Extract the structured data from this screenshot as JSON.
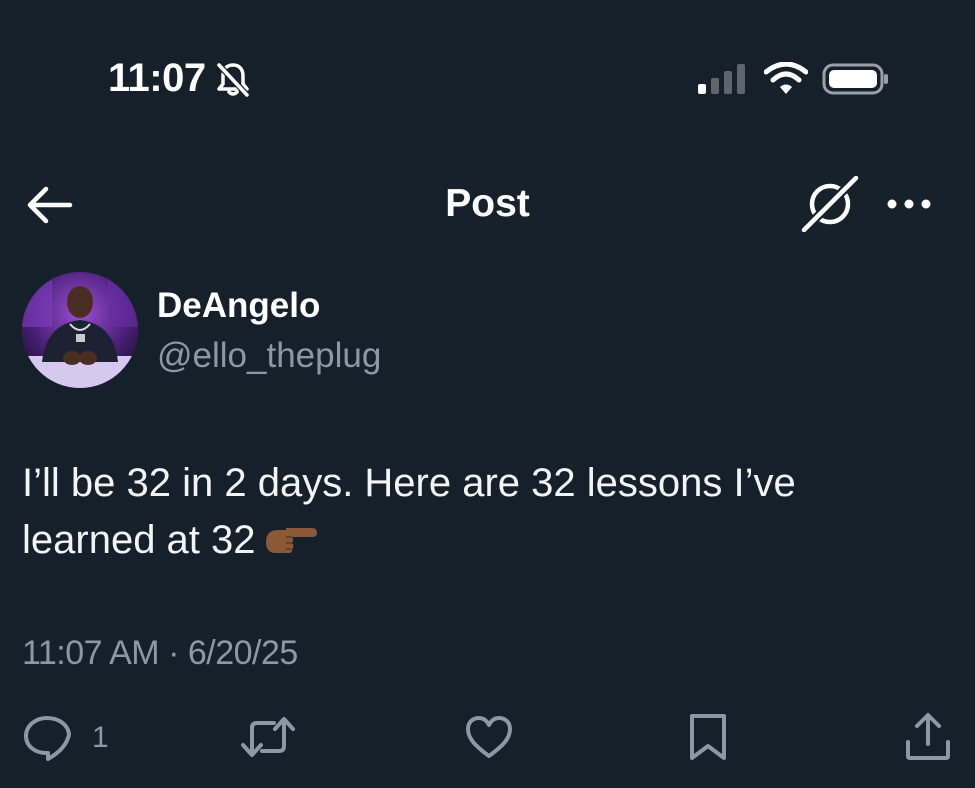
{
  "status_bar": {
    "time": "11:07"
  },
  "header": {
    "title": "Post"
  },
  "author": {
    "display_name": "DeAngelo",
    "handle": "@ello_theplug"
  },
  "post": {
    "line1": "I’ll be 32 in 2 days. Here are 32 lessons I’ve",
    "line2": "learned at 32",
    "timestamp": "11:07 AM · 6/20/25"
  },
  "actions": {
    "reply_count": "1"
  },
  "colors": {
    "background": "#15202b",
    "secondary_text": "#8b98a5"
  },
  "icons": [
    "bell-slash-icon",
    "signal-icon",
    "wifi-icon",
    "battery-icon",
    "back-arrow-icon",
    "grok-icon",
    "more-icon",
    "reply-icon",
    "retweet-icon",
    "like-icon",
    "bookmark-icon",
    "share-icon",
    "pointing-emoji-icon"
  ]
}
